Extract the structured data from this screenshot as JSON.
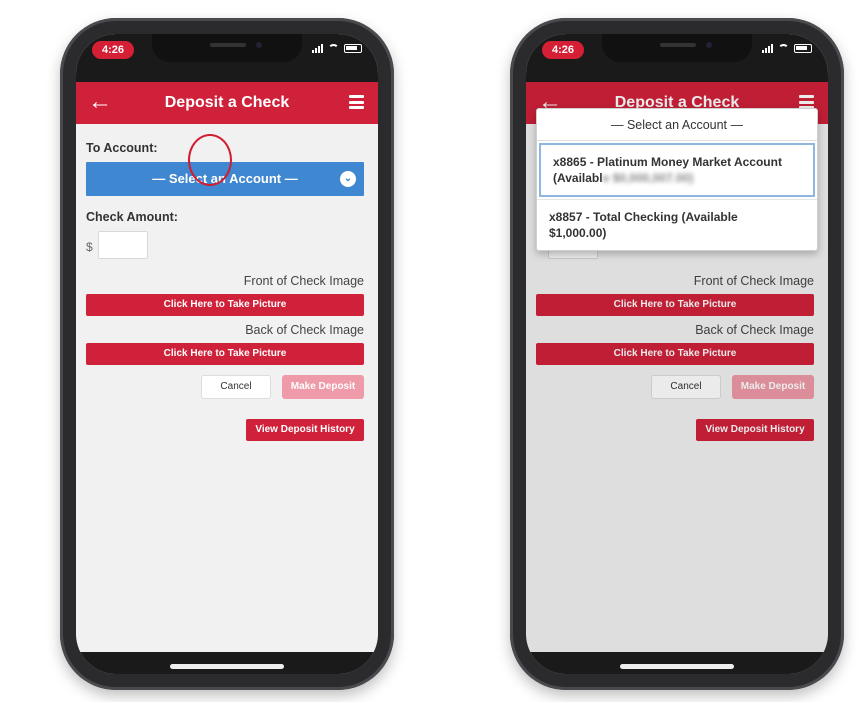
{
  "status": {
    "time": "4:26"
  },
  "app": {
    "title": "Deposit a Check",
    "back_icon": "arrow-left-icon",
    "menu_icon": "hamburger-menu-icon",
    "accent_color": "#d0213a",
    "select_color": "#3f87d0"
  },
  "form": {
    "to_account_label": "To Account:",
    "select_placeholder": "— Select an Account —",
    "check_amount_label": "Check Amount:",
    "currency_symbol": "$",
    "front_label": "Front of Check Image",
    "back_label": "Back of Check Image",
    "take_picture_label": "Click Here to Take Picture",
    "cancel_label": "Cancel",
    "make_deposit_label": "Make Deposit",
    "history_label": "View Deposit History"
  },
  "dropdown": {
    "header": "— Select an Account —",
    "options": [
      {
        "line1": "x8865 - Platinum Money Market Account",
        "line2_prefix": "(Availabl",
        "line2_blurred": "e $0,000,007.00)"
      },
      {
        "line1": "x8857 - Total Checking (Available",
        "line2": "$1,000.00)"
      }
    ]
  }
}
